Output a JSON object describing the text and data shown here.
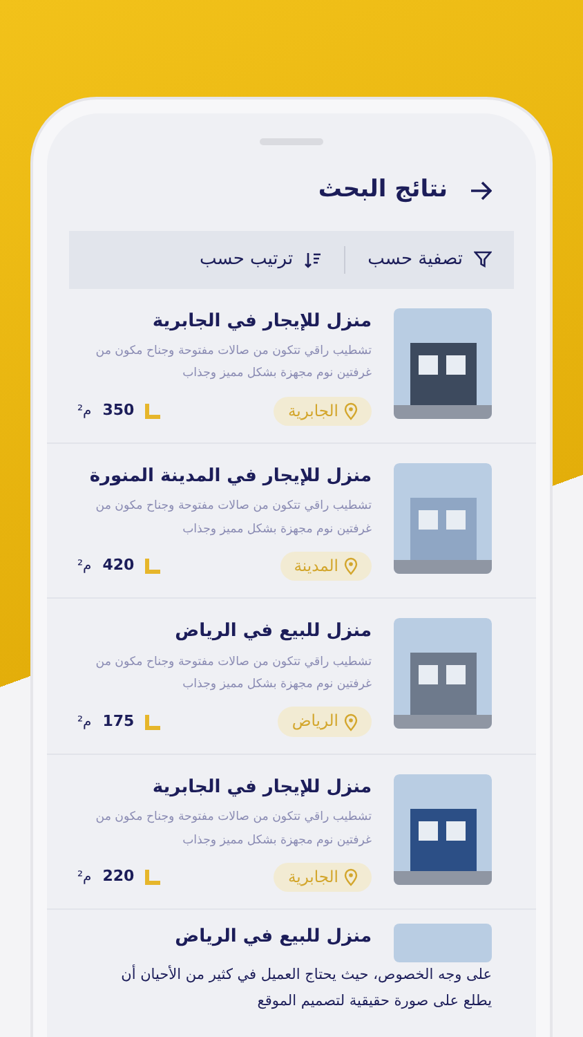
{
  "header": {
    "title": "نتائج البحث"
  },
  "toolbar": {
    "filter_label": "تصفية حسب",
    "sort_label": "ترتيب حسب"
  },
  "listings": [
    {
      "title": "منزل للإيجار في الجابرية",
      "description": "تشطيب راقي تتكون من صالات مفتوحة وجناح مكون من غرفتين نوم مجهزة بشكل مميز وجذاب",
      "location": "الجابرية",
      "area": "350",
      "unit": "م²",
      "color": "#3d4a5e"
    },
    {
      "title": "منزل للإيجار في المدينة المنورة",
      "description": "تشطيب راقي تتكون من صالات مفتوحة وجناح مكون من غرفتين نوم مجهزة بشكل مميز وجذاب",
      "location": "المدينة",
      "area": "420",
      "unit": "م²",
      "color": "#8fa6c4"
    },
    {
      "title": "منزل للبيع في الرياض",
      "description": "تشطيب راقي تتكون من صالات مفتوحة وجناح مكون من غرفتين نوم مجهزة بشكل مميز وجذاب",
      "location": "الرياض",
      "area": "175",
      "unit": "م²",
      "color": "#6e7a8c"
    },
    {
      "title": "منزل للإيجار في الجابرية",
      "description": "تشطيب راقي تتكون من صالات مفتوحة وجناح مكون من غرفتين نوم مجهزة بشكل مميز وجذاب",
      "location": "الجابرية",
      "area": "220",
      "unit": "م²",
      "color": "#2c4f86"
    }
  ],
  "partial_listing": {
    "title": "منزل للبيع في الرياض"
  },
  "overlay_text": [
    "على وجه الخصوص، حيث يحتاج العميل في كثير من الأحيان أن",
    "يطلع على صورة حقيقية لتصميم الموقع"
  ]
}
